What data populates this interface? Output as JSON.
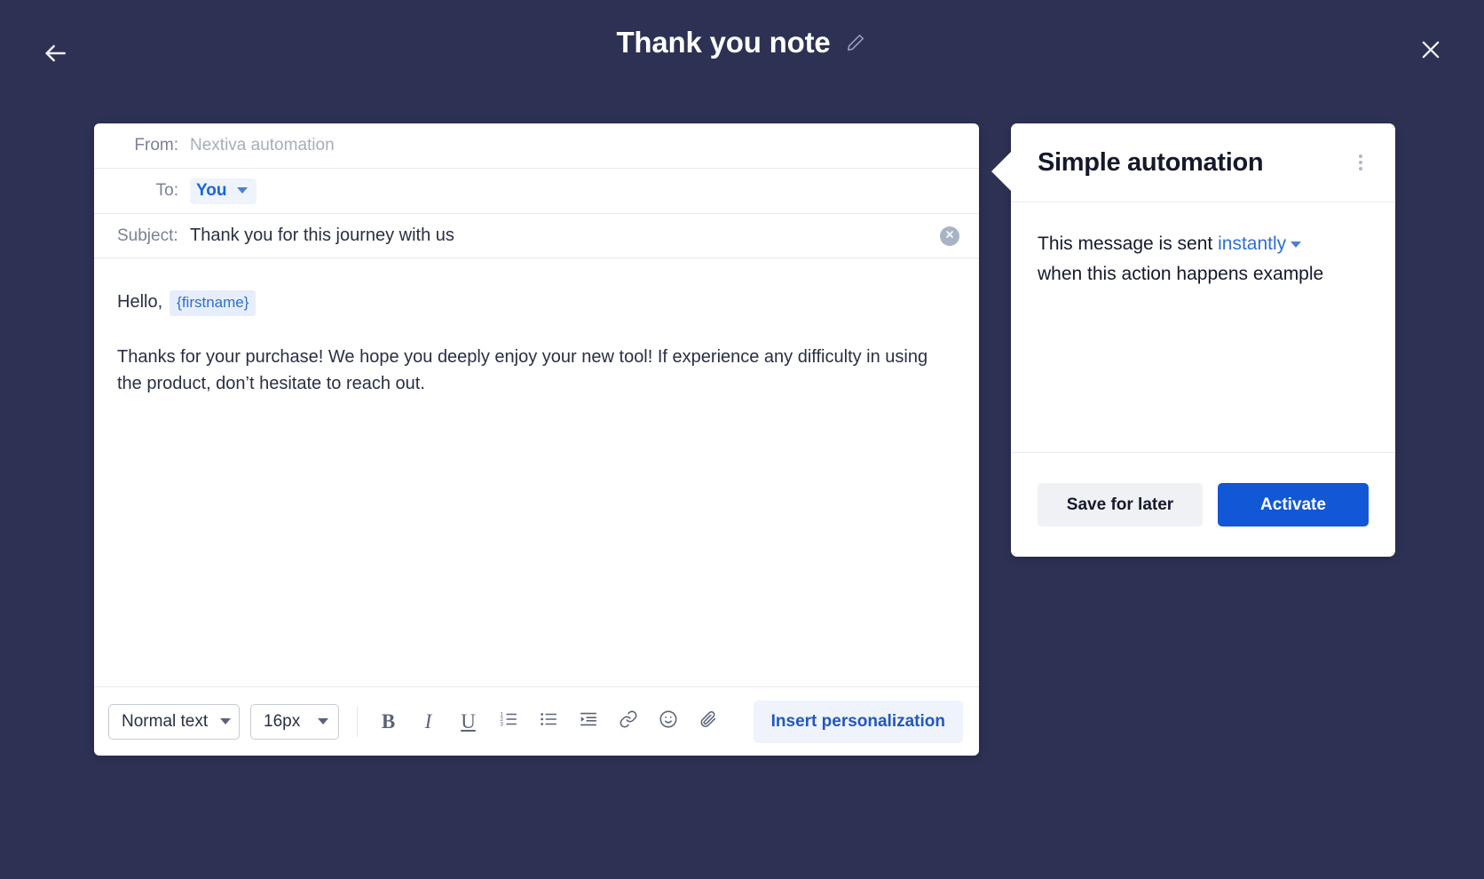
{
  "topbar": {
    "back_icon": "arrow-left-icon",
    "title": "Thank you note",
    "edit_icon": "pencil-icon",
    "close_icon": "close-icon"
  },
  "composer": {
    "from": {
      "label": "From:",
      "value": "Nextiva automation"
    },
    "to": {
      "label": "To:",
      "value": "You",
      "caret_icon": "chevron-down-icon"
    },
    "subject": {
      "label": "Subject:",
      "value": "Thank you for this journey with us",
      "clear_icon": "clear-circle-icon"
    },
    "body": {
      "greeting": "Hello,",
      "token": "{firstname}",
      "paragraph": "Thanks for your purchase! We hope you deeply enjoy your new tool! If experience any difficulty in using the product, don’t hesitate to reach out."
    },
    "toolbar": {
      "text_style": "Normal text",
      "font_size": "16px",
      "bold": "B",
      "italic": "I",
      "underline": "U",
      "ordered_list_icon": "ordered-list-icon",
      "bullet_list_icon": "bullet-list-icon",
      "indent_icon": "indent-icon",
      "link_icon": "link-icon",
      "emoji_icon": "emoji-icon",
      "attachment_icon": "paperclip-icon",
      "insert_personalization": "Insert personalization"
    }
  },
  "panel": {
    "title": "Simple automation",
    "menu_icon": "kebab-menu-icon",
    "sentence_prefix": "This message is sent ",
    "sentence_link": "instantly",
    "sentence_suffix": " when this action happens example",
    "save_label": "Save for later",
    "activate_label": "Activate"
  },
  "colors": {
    "background": "#2d3153",
    "primary": "#1257d6",
    "link": "#2f6fd0",
    "card": "#ffffff"
  }
}
